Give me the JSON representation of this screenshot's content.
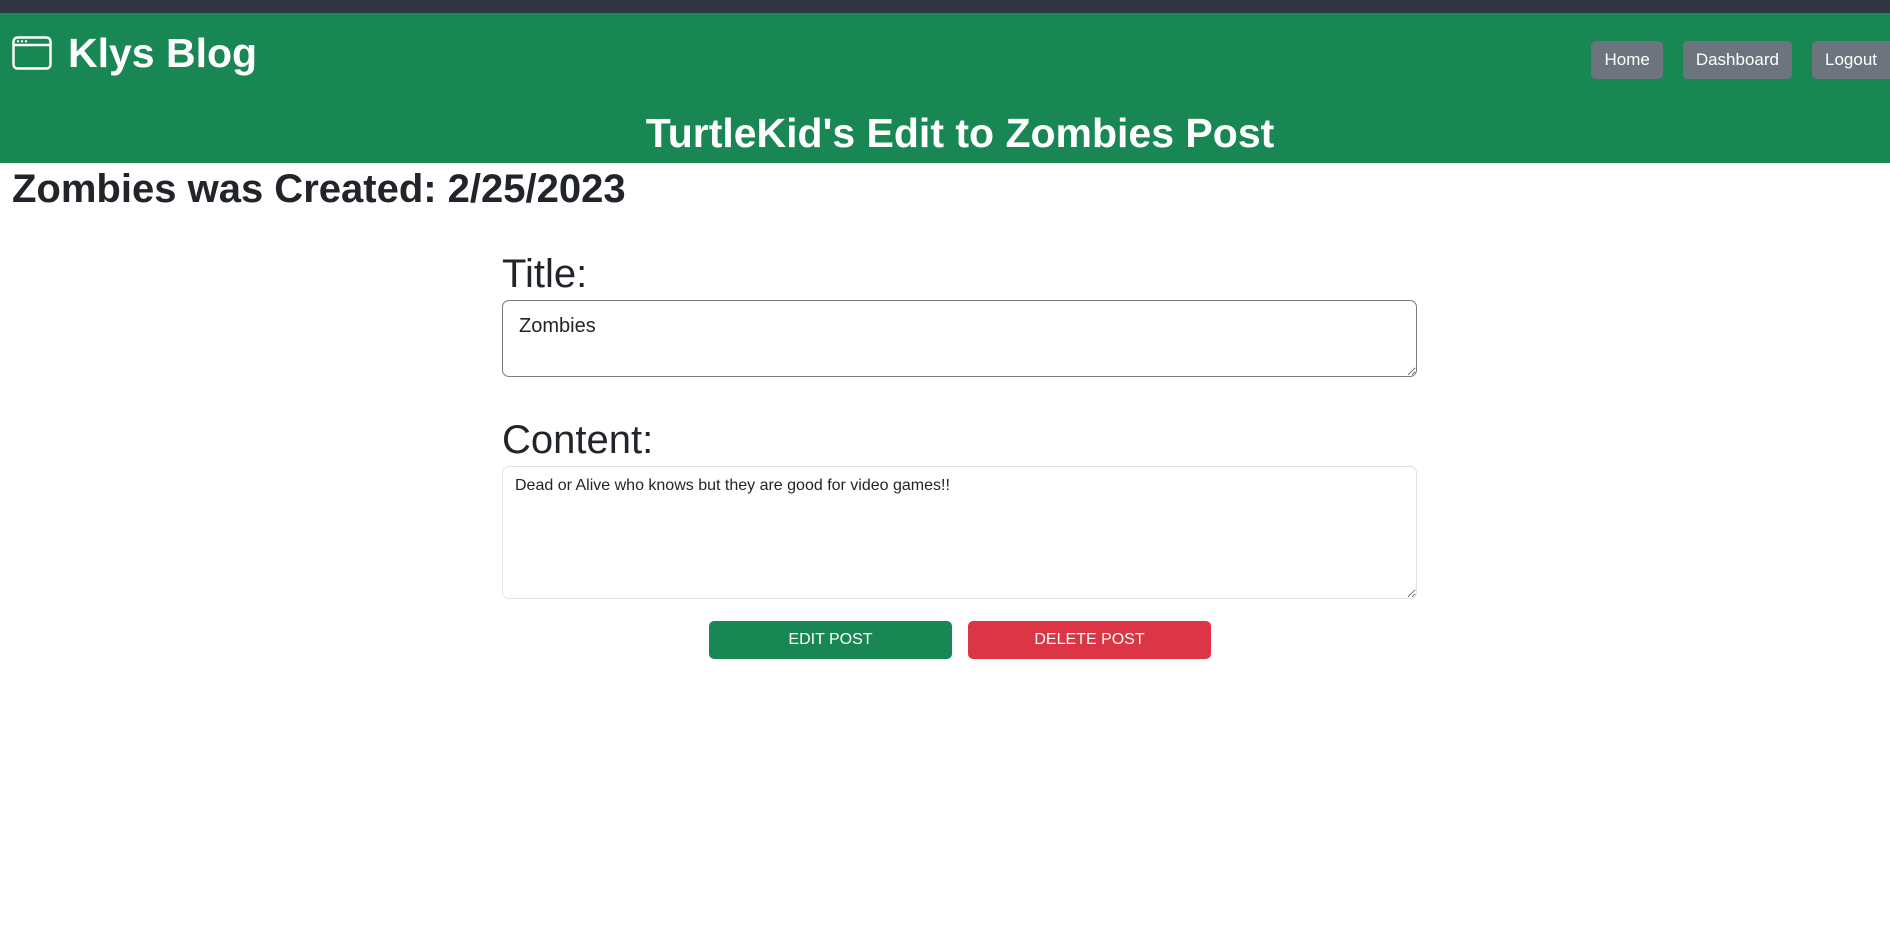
{
  "brand": {
    "icon": "browser-window-icon",
    "name": "Klys Blog"
  },
  "nav": {
    "home": "Home",
    "dashboard": "Dashboard",
    "logout": "Logout"
  },
  "page": {
    "title": "TurtleKid's Edit to Zombies Post",
    "created": "Zombies was Created: 2/25/2023"
  },
  "form": {
    "title_label": "Title:",
    "title_value": "Zombies",
    "content_label": "Content:",
    "content_value": "Dead or Alive who knows but they are good for video games!!"
  },
  "actions": {
    "edit": "EDIT POST",
    "delete": "DELETE POST"
  },
  "colors": {
    "header_bg": "#198754",
    "nav_button": "#6c757d",
    "edit_button": "#198754",
    "delete_button": "#dc3545"
  }
}
